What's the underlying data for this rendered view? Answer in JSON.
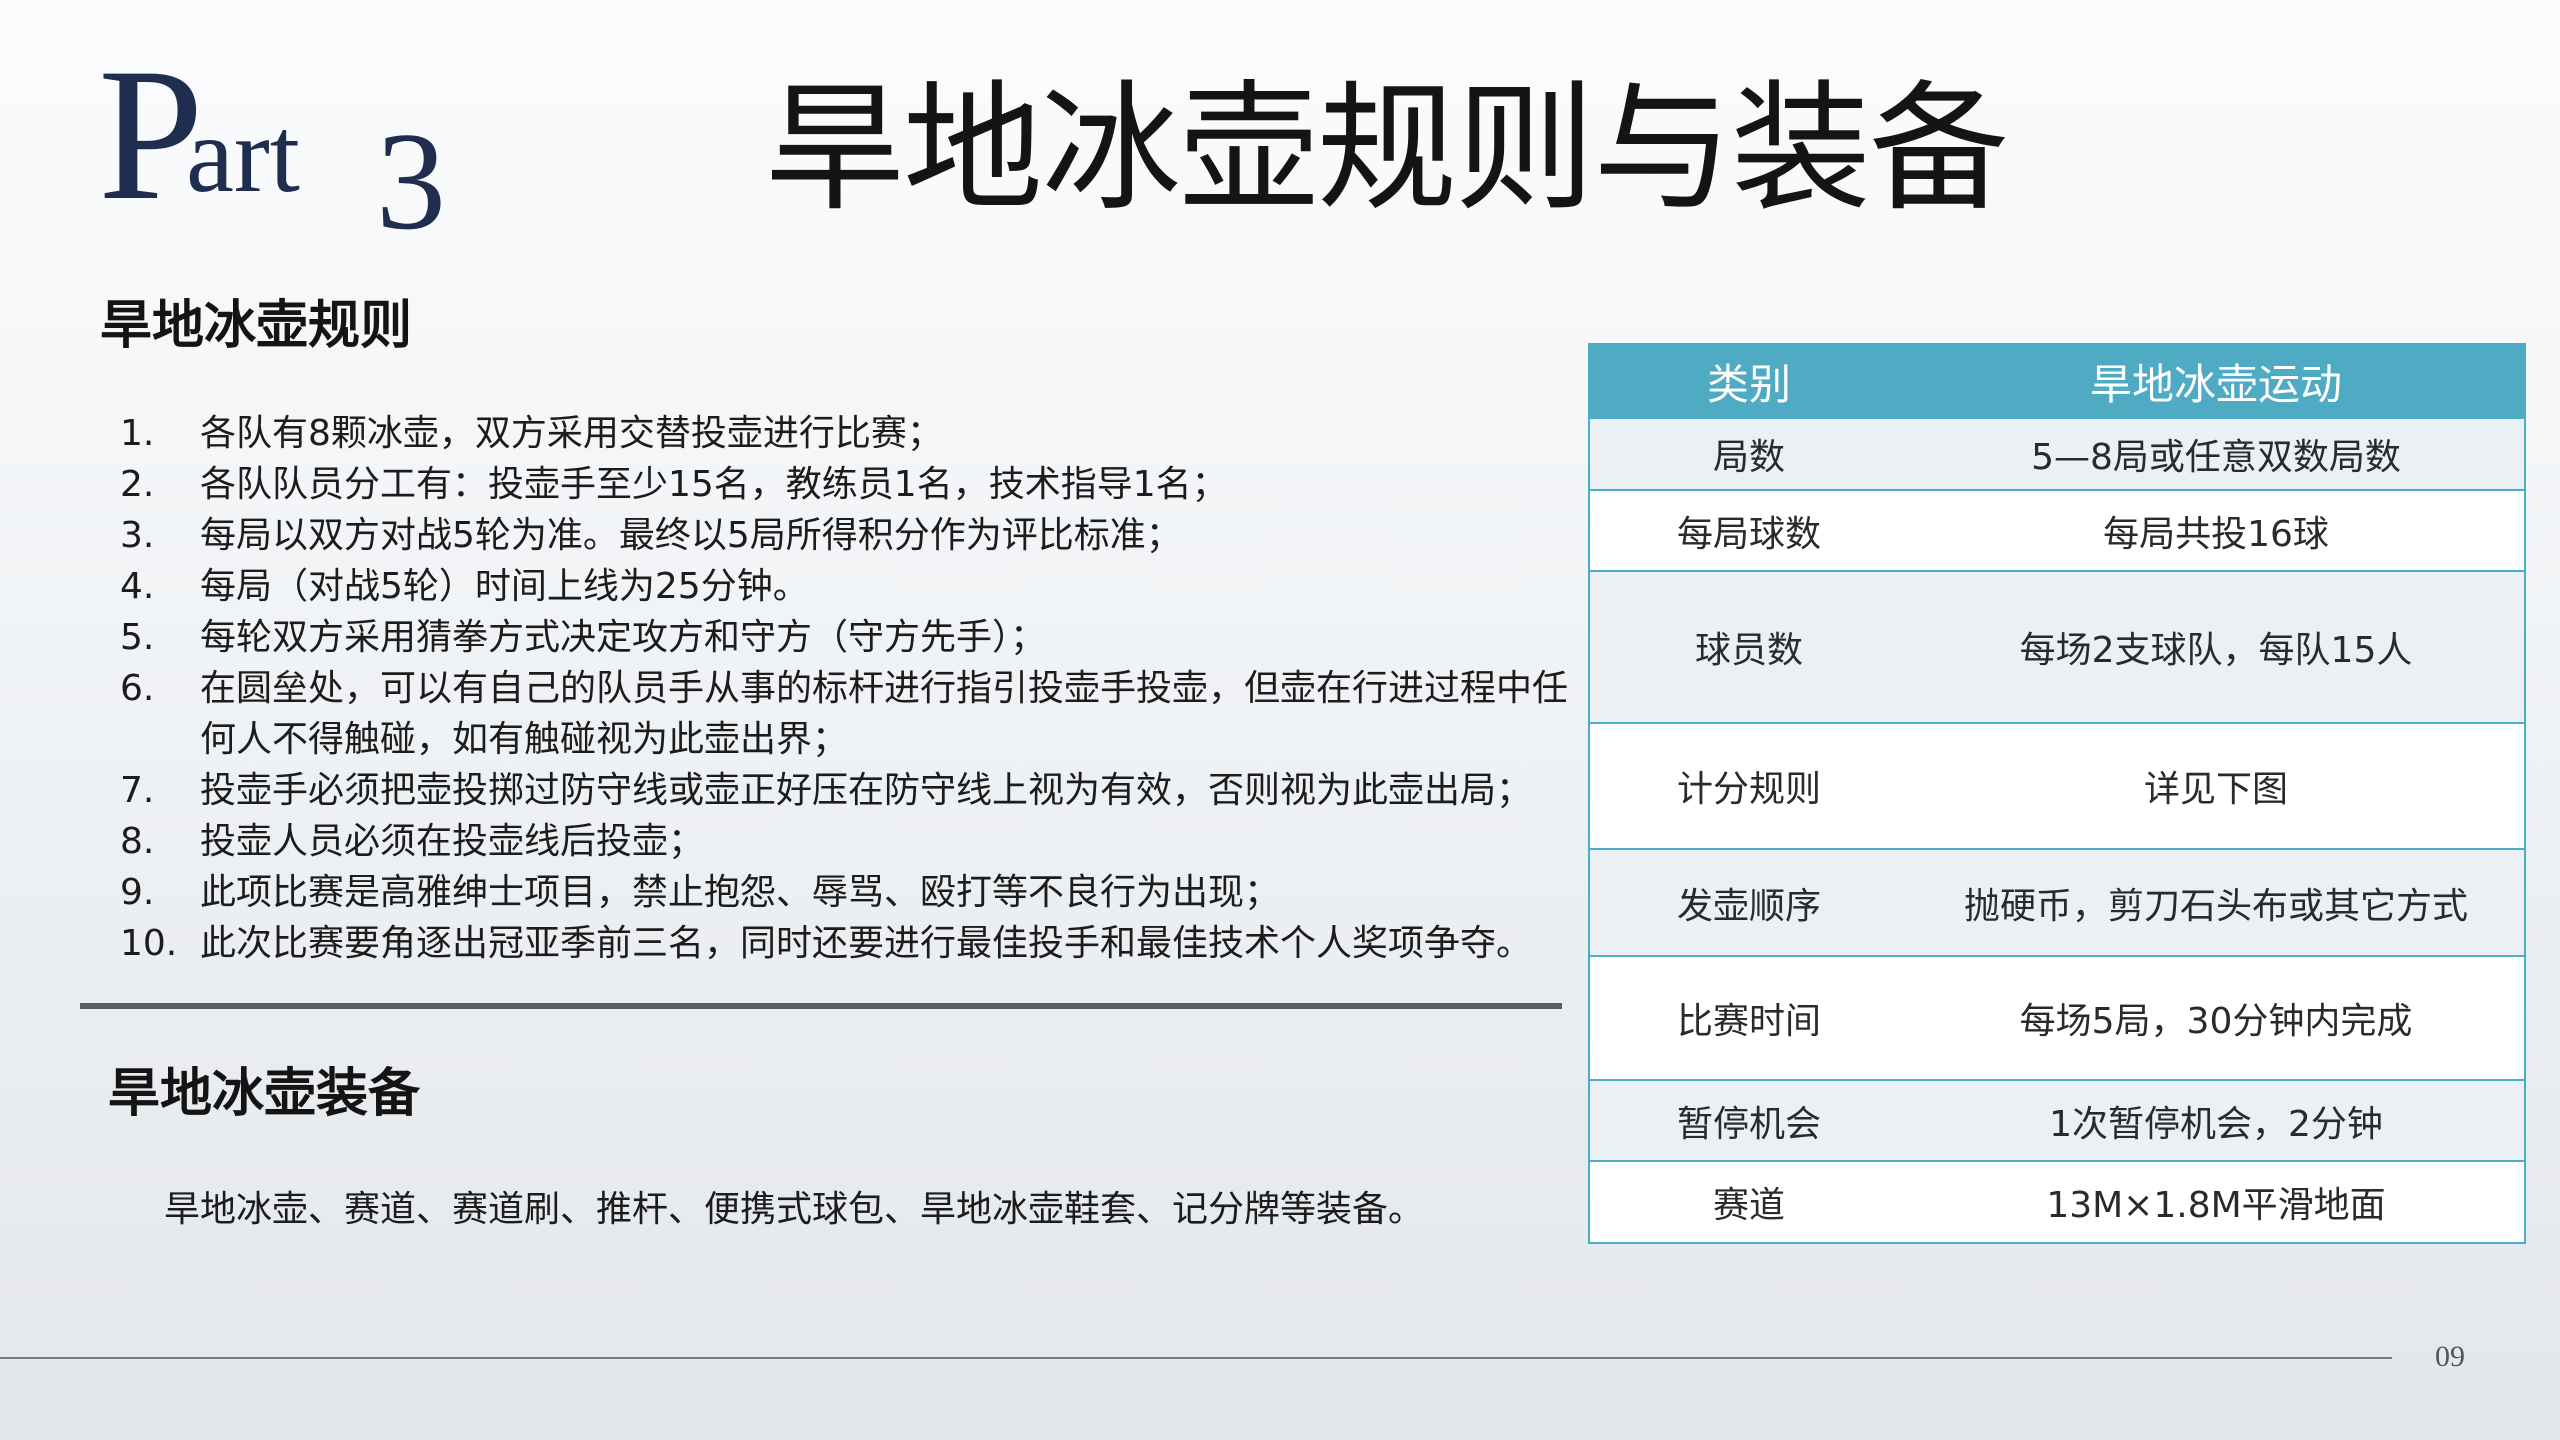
{
  "header": {
    "part_p": "P",
    "part_art": "art",
    "part_number": "3",
    "title": "旱地冰壶规则与装备"
  },
  "rules": {
    "title": "旱地冰壶规则",
    "items": [
      {
        "n": "1.",
        "text": "各队有8颗冰壶，双方采用交替投壶进行比赛；"
      },
      {
        "n": "2.",
        "text": "各队队员分工有：投壶手至少15名，教练员1名，技术指导1名；"
      },
      {
        "n": "3.",
        "text": "每局以双方对战5轮为准。最终以5局所得积分作为评比标准；"
      },
      {
        "n": "4.",
        "text": "每局（对战5轮）时间上线为25分钟。"
      },
      {
        "n": "5.",
        "text": "每轮双方采用猜拳方式决定攻方和守方（守方先手）；"
      },
      {
        "n": "6.",
        "text": "在圆垒处，可以有自己的队员手从事的标杆进行指引投壶手投壶，但壶在行进过程中任何人不得触碰，如有触碰视为此壶出界；"
      },
      {
        "n": "7.",
        "text": "投壶手必须把壶投掷过防守线或壶正好压在防守线上视为有效，否则视为此壶出局；"
      },
      {
        "n": "8.",
        "text": "投壶人员必须在投壶线后投壶；"
      },
      {
        "n": "9.",
        "text": "此项比赛是高雅绅士项目，禁止抱怨、辱骂、殴打等不良行为出现；"
      },
      {
        "n": "10.",
        "text": "此次比赛要角逐出冠亚季前三名，同时还要进行最佳投手和最佳技术个人奖项争夺。"
      }
    ]
  },
  "equipment": {
    "title": "旱地冰壶装备",
    "text": "旱地冰壶、赛道、赛道刷、推杆、便携式球包、旱地冰壶鞋套、记分牌等装备。"
  },
  "table": {
    "headers": [
      "类别",
      "旱地冰壶运动"
    ],
    "rows": [
      {
        "category": "局数",
        "value": "5—8局或任意双数局数"
      },
      {
        "category": "每局球数",
        "value": "每局共投16球"
      },
      {
        "category": "球员数",
        "value": "每场2支球队，每队15人"
      },
      {
        "category": "计分规则",
        "value": "详见下图"
      },
      {
        "category": "发壶顺序",
        "value": "抛硬币，剪刀石头布或其它方式"
      },
      {
        "category": "比赛时间",
        "value": "每场5局，30分钟内完成"
      },
      {
        "category": "暂停机会",
        "value": "1次暂停机会，2分钟"
      },
      {
        "category": "赛道",
        "value": "13M×1.8M平滑地面"
      }
    ]
  },
  "footer": {
    "page_number": "09"
  },
  "colors": {
    "table_header": "#4fabc4",
    "table_border": "#4aaec8",
    "table_alt_row": "#eaf0f4",
    "part_text": "#1f2d4e"
  }
}
